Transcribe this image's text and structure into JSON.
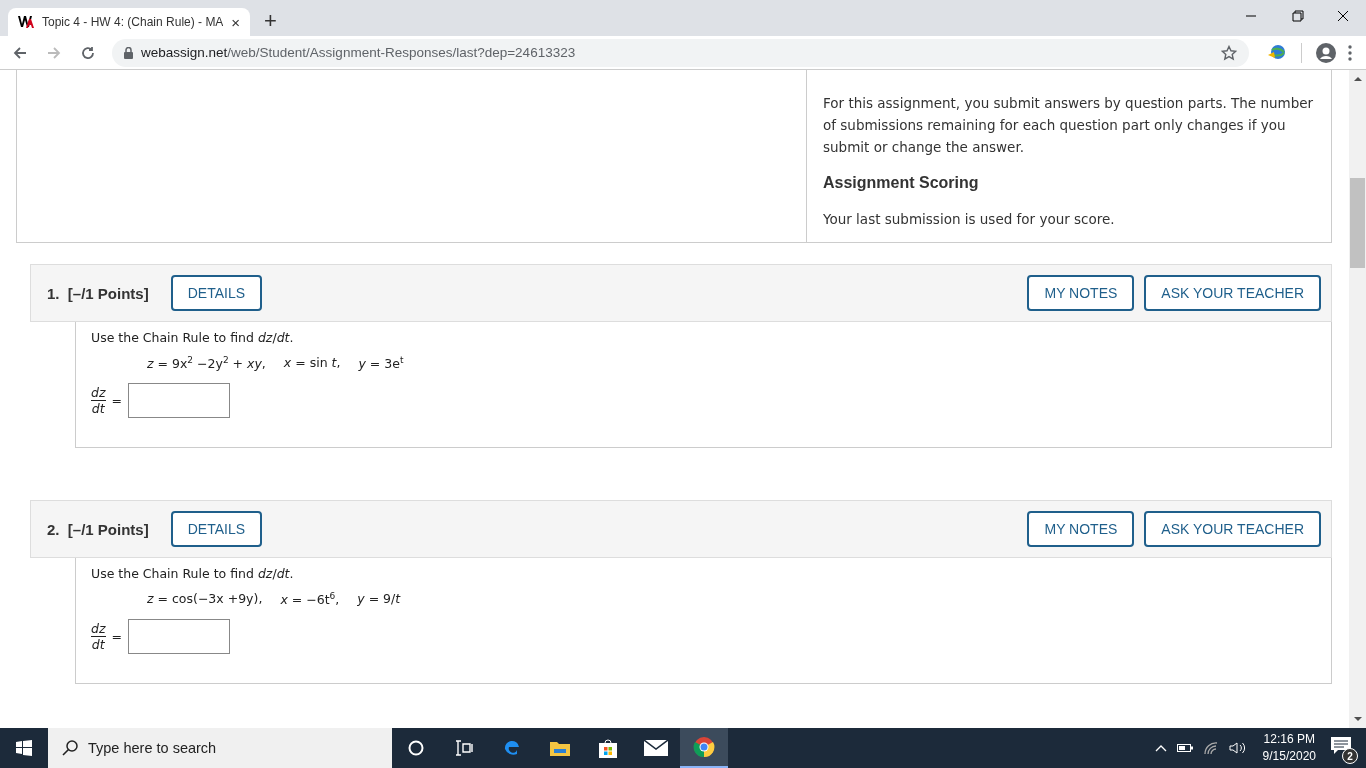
{
  "browser": {
    "tab": {
      "title": "Topic 4 - HW 4: (Chain Rule) - MA",
      "close": "×"
    },
    "new_tab": "+",
    "url": {
      "host": "webassign.net",
      "path": "/web/Student/Assignment-Responses/last?dep=24613323"
    }
  },
  "info": {
    "paragraph": "For this assignment, you submit answers by question parts. The number of submissions remaining for each question part only changes if you submit or change the answer.",
    "heading": "Assignment Scoring",
    "scoring": "Your last submission is used for your score."
  },
  "questions": [
    {
      "number": "1.",
      "points": "[–/1 Points]",
      "details": "DETAILS",
      "notes": "MY NOTES",
      "ask": "ASK YOUR TEACHER",
      "prompt": "Use the Chain Rule to find *dz*/*dt*.",
      "equations": [
        "*z* = 9x$^{2}$ −2y$^{2}$ + *xy*,",
        "*x* = sin *t*,",
        "*y* = 3e$^{t}$"
      ],
      "numerator": "dz",
      "denominator": "dt",
      "equals": "="
    },
    {
      "number": "2.",
      "points": "[–/1 Points]",
      "details": "DETAILS",
      "notes": "MY NOTES",
      "ask": "ASK YOUR TEACHER",
      "prompt": "Use the Chain Rule to find *dz*/*dt*.",
      "equations": [
        "*z* = cos(−3x +9y),",
        "*x* = −6t$^{6}$,",
        "*y* = 9/*t*"
      ],
      "numerator": "dz",
      "denominator": "dt",
      "equals": "="
    }
  ],
  "taskbar": {
    "search_placeholder": "Type here to search",
    "time": "12:16 PM",
    "date": "9/15/2020",
    "notifications": "2"
  }
}
